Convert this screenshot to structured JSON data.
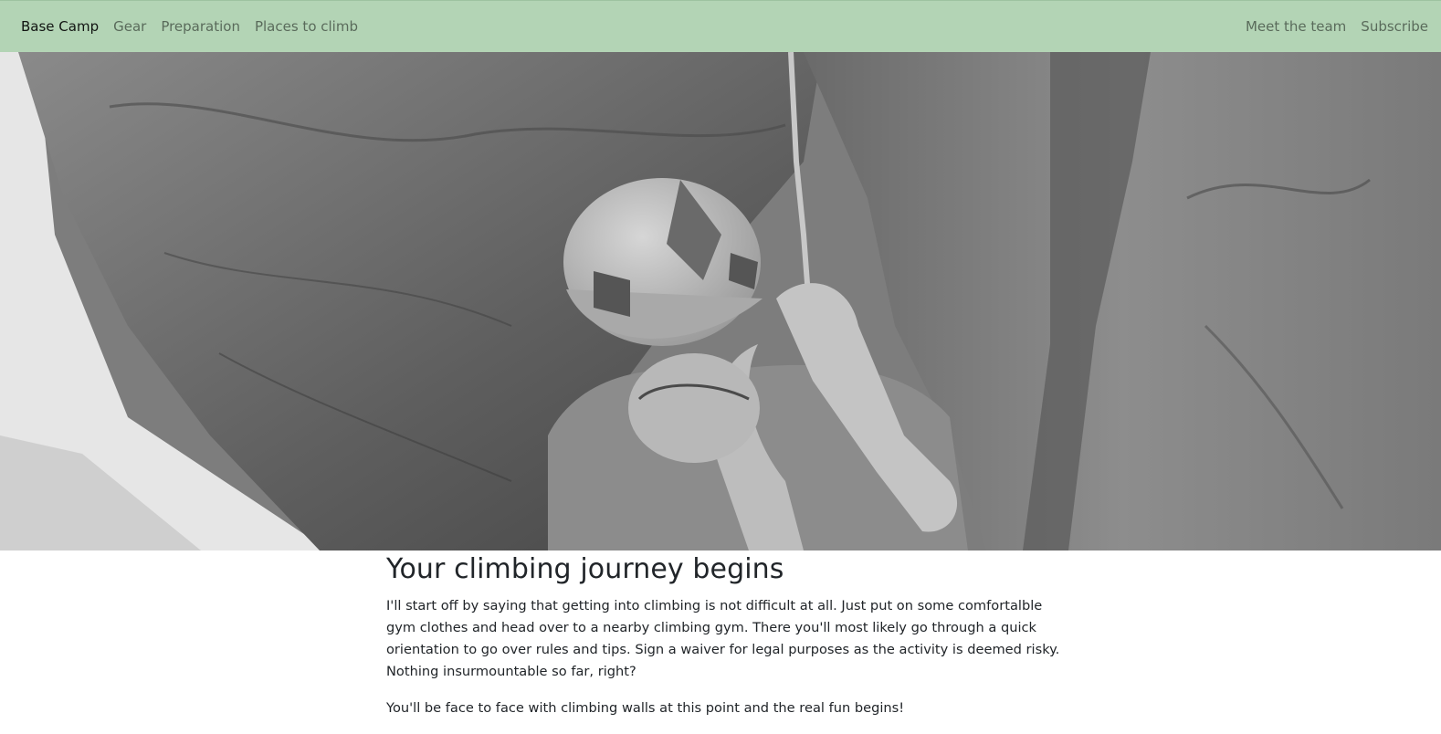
{
  "nav": {
    "brand": "Base Camp",
    "left_links": [
      "Gear",
      "Preparation",
      "Places to climb"
    ],
    "right_links": [
      "Meet the team",
      "Subscribe"
    ]
  },
  "hero": {
    "image": "grayscale photo of a climber in a helmet holding a rope beneath a rock overhang"
  },
  "article": {
    "title": "Your climbing journey begins",
    "paragraphs": [
      "I'll start off by saying that getting into climbing is not difficult at all. Just put on some comfortalble gym clothes and head over to a nearby climbing gym. There you'll most likely go through a quick orientation to go over rules and tips. Sign a waiver for legal purposes as the activity is deemed risky. Nothing insurmountable so far, right?",
      "You'll be face to face with climbing walls at this point and the real fun begins!"
    ]
  },
  "colors": {
    "navbar_bg": "#b3d4b5",
    "text": "#212529",
    "nav_link": "rgba(0,0,0,0.5)"
  }
}
